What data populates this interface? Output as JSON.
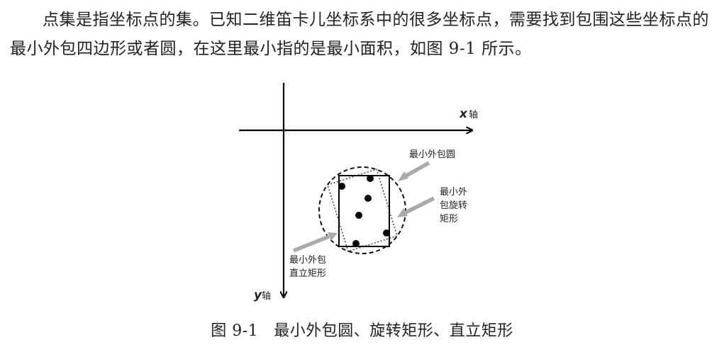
{
  "paragraph": {
    "text": "点集是指坐标点的集。已知二维笛卡儿坐标系中的很多坐标点，需要找到包围这些坐标点的最小外包四边形或者圆，在这里最小指的是最小面积，如图 9-1 所示。"
  },
  "figure": {
    "x_axis_label": "x",
    "x_axis_suffix": "轴",
    "y_axis_label": "y",
    "y_axis_suffix": "轴",
    "label_circle": "最小外包圆",
    "label_rotated": [
      "最小外",
      "包旋转",
      "矩形"
    ],
    "label_upright": [
      "最小外包",
      "直立矩形"
    ]
  },
  "caption": {
    "number": "图 9-1",
    "title": "最小外包圆、旋转矩形、直立矩形"
  }
}
